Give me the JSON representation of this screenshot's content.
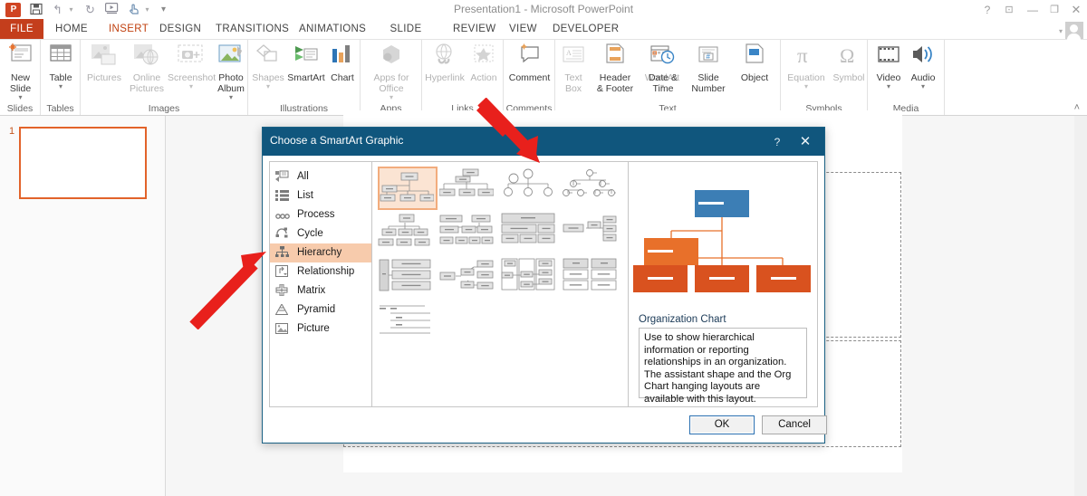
{
  "window": {
    "title": "Presentation1 - Microsoft PowerPoint",
    "logo": "P",
    "controls": {
      "help": "?",
      "ribbon_display": "⊡",
      "minimize": "—",
      "restore": "❐",
      "close": "✕"
    }
  },
  "quick_access": {
    "save": "💾",
    "undo": "↰",
    "undo_caret": "▾",
    "redo": "↻",
    "start_show": "▭",
    "touch_mode": "☝",
    "touch_caret": "▾",
    "more": "▾"
  },
  "tabs": [
    {
      "label": "FILE",
      "state": "file"
    },
    {
      "label": "HOME",
      "state": "normal"
    },
    {
      "label": "INSERT",
      "state": "active"
    },
    {
      "label": "DESIGN",
      "state": "normal"
    },
    {
      "label": "TRANSITIONS",
      "state": "normal"
    },
    {
      "label": "ANIMATIONS",
      "state": "normal"
    },
    {
      "label": "SLIDE SHOW",
      "state": "normal"
    },
    {
      "label": "REVIEW",
      "state": "normal"
    },
    {
      "label": "VIEW",
      "state": "normal"
    },
    {
      "label": "DEVELOPER",
      "state": "normal"
    }
  ],
  "ribbon": {
    "collapse": "˄",
    "groups": [
      {
        "name": "Slides",
        "commands": [
          {
            "label": "New\nSlide",
            "caret": "▾",
            "dim": false
          }
        ]
      },
      {
        "name": "Tables",
        "commands": [
          {
            "label": "Table",
            "caret": "▾",
            "dim": false
          }
        ]
      },
      {
        "name": "Images",
        "commands": [
          {
            "label": "Pictures",
            "caret": "",
            "dim": true
          },
          {
            "label": "Online\nPictures",
            "caret": "",
            "dim": true
          },
          {
            "label": "Screenshot",
            "caret": "▾",
            "dim": true
          },
          {
            "label": "Photo\nAlbum",
            "caret": "▾",
            "dim": false
          }
        ]
      },
      {
        "name": "Illustrations",
        "commands": [
          {
            "label": "Shapes",
            "caret": "▾",
            "dim": true
          },
          {
            "label": "SmartArt",
            "caret": "",
            "dim": false
          },
          {
            "label": "Chart",
            "caret": "",
            "dim": false
          }
        ]
      },
      {
        "name": "Apps",
        "commands": [
          {
            "label": "Apps for\nOffice",
            "caret": "▾",
            "dim": true
          }
        ]
      },
      {
        "name": "Links",
        "commands": [
          {
            "label": "Hyperlink",
            "caret": "",
            "dim": true
          },
          {
            "label": "Action",
            "caret": "",
            "dim": true
          }
        ]
      },
      {
        "name": "Comments",
        "commands": [
          {
            "label": "Comment",
            "caret": "",
            "dim": false
          }
        ]
      },
      {
        "name": "Text",
        "commands": [
          {
            "label": "Text\nBox",
            "caret": "",
            "dim": true
          },
          {
            "label": "Header\n& Footer",
            "caret": "",
            "dim": false
          },
          {
            "label": "WordArt",
            "caret": "▾",
            "dim": true
          },
          {
            "label": "Date &\nTime",
            "caret": "",
            "dim": false
          },
          {
            "label": "Slide\nNumber",
            "caret": "",
            "dim": false
          },
          {
            "label": "Object",
            "caret": "",
            "dim": false
          }
        ]
      },
      {
        "name": "Symbols",
        "commands": [
          {
            "label": "Equation",
            "caret": "▾",
            "dim": true
          },
          {
            "label": "Symbol",
            "caret": "",
            "dim": true
          }
        ]
      },
      {
        "name": "Media",
        "commands": [
          {
            "label": "Video",
            "caret": "▾",
            "dim": false
          },
          {
            "label": "Audio",
            "caret": "▾",
            "dim": false
          }
        ]
      }
    ]
  },
  "slide_pane": {
    "slide_number": "1"
  },
  "dialog": {
    "title": "Choose a SmartArt Graphic",
    "help_label": "?",
    "close_label": "✕",
    "categories": [
      {
        "label": "All",
        "icon": "all-icon",
        "selected": false
      },
      {
        "label": "List",
        "icon": "list-icon",
        "selected": false
      },
      {
        "label": "Process",
        "icon": "process-icon",
        "selected": false
      },
      {
        "label": "Cycle",
        "icon": "cycle-icon",
        "selected": false
      },
      {
        "label": "Hierarchy",
        "icon": "hierarchy-icon",
        "selected": true
      },
      {
        "label": "Relationship",
        "icon": "relationship-icon",
        "selected": false
      },
      {
        "label": "Matrix",
        "icon": "matrix-icon",
        "selected": false
      },
      {
        "label": "Pyramid",
        "icon": "pyramid-icon",
        "selected": false
      },
      {
        "label": "Picture",
        "icon": "picture-icon",
        "selected": false
      }
    ],
    "gallery_selected_index": 0,
    "preview": {
      "name": "Organization Chart",
      "description": "Use to show hierarchical information or reporting relationships in an organization. The assistant shape and the Org Chart hanging layouts are available with this layout.",
      "top_node_color": "#3c7eb5",
      "node_color": "#e8702a"
    },
    "buttons": {
      "ok": "OK",
      "cancel": "Cancel"
    }
  },
  "annotations": {
    "arrow_color": "#e8201c",
    "arrows": [
      {
        "name": "arrow-to-gallery-first-item"
      },
      {
        "name": "arrow-to-hierarchy-category"
      }
    ]
  }
}
